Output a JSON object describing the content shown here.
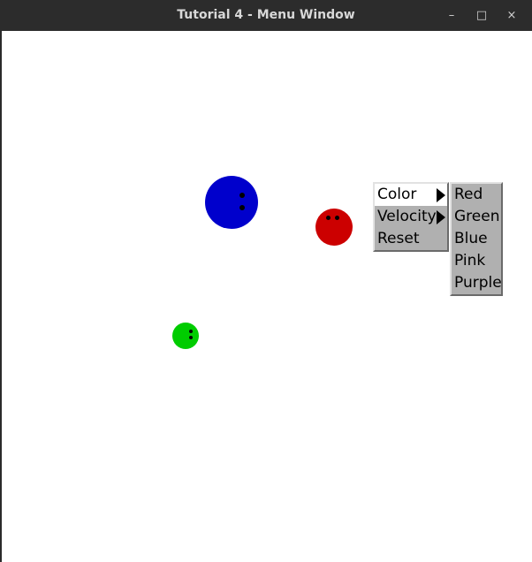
{
  "window": {
    "title": "Tutorial 4 - Menu Window",
    "controls": {
      "minimize": "–",
      "maximize": "□",
      "close": "×"
    }
  },
  "balls": [
    {
      "name": "blue-ball",
      "color": "#0000cc"
    },
    {
      "name": "red-ball",
      "color": "#cc0000"
    },
    {
      "name": "green-ball",
      "color": "#00cc00"
    }
  ],
  "menu": {
    "items": [
      {
        "label": "Color",
        "has_submenu": true,
        "active": true
      },
      {
        "label": "Velocity",
        "has_submenu": true,
        "active": false
      },
      {
        "label": "Reset",
        "has_submenu": false,
        "active": false
      }
    ]
  },
  "submenu": {
    "items": [
      {
        "label": "Red"
      },
      {
        "label": "Green"
      },
      {
        "label": "Blue"
      },
      {
        "label": "Pink"
      },
      {
        "label": "Purple"
      }
    ]
  }
}
